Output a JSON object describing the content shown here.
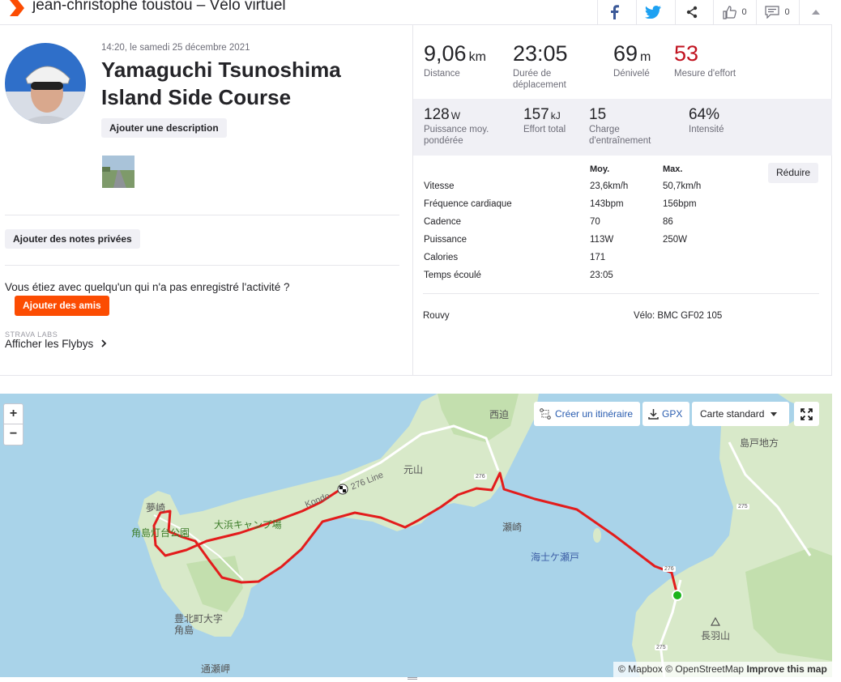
{
  "header": {
    "title": "jean-christophe toustou – Vélo virtuel",
    "likes_count": "0",
    "comments_count": "0"
  },
  "activity": {
    "date": "14:20, le samedi 25 décembre 2021",
    "name": "Yamaguchi Tsunoshima Island Side Course",
    "add_description_label": "Ajouter une description",
    "private_notes_label": "Ajouter des notes privées",
    "companion_text": "Vous étiez avec quelqu'un qui n'a pas enregistré l'activité ?",
    "add_friends_label": "Ajouter des amis",
    "labs_label": "STRAVA LABS",
    "flybys_label": "Afficher les Flybys"
  },
  "stats_primary": [
    {
      "value": "9,06",
      "unit": "km",
      "label": "Distance"
    },
    {
      "value": "23:05",
      "unit": "",
      "label": "Durée de déplacement"
    },
    {
      "value": "69",
      "unit": "m",
      "label": "Dénivelé"
    },
    {
      "value": "53",
      "unit": "",
      "label": "Mesure d'effort"
    }
  ],
  "stats_secondary": [
    {
      "value": "128",
      "unit": "W",
      "label": "Puissance moy. pondérée"
    },
    {
      "value": "157",
      "unit": "kJ",
      "label": "Effort total"
    },
    {
      "value": "15",
      "unit": "",
      "label": "Charge d'entraînement"
    },
    {
      "value": "64%",
      "unit": "",
      "label": "Intensité"
    }
  ],
  "details": {
    "col_avg": "Moy.",
    "col_max": "Max.",
    "reduce_label": "Réduire",
    "rows": [
      {
        "label": "Vitesse",
        "avg": "23,6km/h",
        "max": "50,7km/h"
      },
      {
        "label": "Fréquence cardiaque",
        "avg": "143bpm",
        "max": "156bpm"
      },
      {
        "label": "Cadence",
        "avg": "70",
        "max": "86"
      },
      {
        "label": "Puissance",
        "avg": "113W",
        "max": "250W"
      },
      {
        "label": "Calories",
        "avg": "171",
        "max": ""
      },
      {
        "label": "Temps écoulé",
        "avg": "23:05",
        "max": ""
      }
    ],
    "device": "Rouvy",
    "bike": "Vélo: BMC GF02 105"
  },
  "map": {
    "zoom_in": "+",
    "zoom_out": "−",
    "create_route_label": "Créer un itinéraire",
    "gpx_label": "GPX",
    "map_style_label": "Carte standard",
    "attribution_mapbox": "© Mapbox",
    "attribution_osm": "© OpenStreetMap",
    "attribution_improve": "Improve this map",
    "labels": [
      "西迫",
      "島戸地方",
      "元山",
      "276 Line",
      "Kondo",
      "夢崎",
      "角島灯台公園",
      "大浜キャンプ場",
      "瀬崎",
      "海士ケ瀬戸",
      "豊北町大字角島",
      "長羽山",
      "通瀬岬"
    ],
    "road_shields": [
      "276",
      "275",
      "276",
      "275"
    ]
  },
  "colors": {
    "brand": "#fc4c02",
    "effort": "#c1121f",
    "route": "#e31c1c",
    "water": "#a9d3e9",
    "land": "#d8e9c9"
  }
}
